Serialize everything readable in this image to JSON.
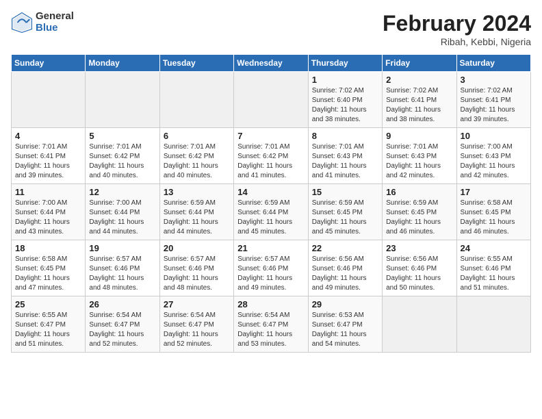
{
  "logo": {
    "general": "General",
    "blue": "Blue"
  },
  "title": "February 2024",
  "location": "Ribah, Kebbi, Nigeria",
  "days_of_week": [
    "Sunday",
    "Monday",
    "Tuesday",
    "Wednesday",
    "Thursday",
    "Friday",
    "Saturday"
  ],
  "weeks": [
    [
      {
        "day": "",
        "info": ""
      },
      {
        "day": "",
        "info": ""
      },
      {
        "day": "",
        "info": ""
      },
      {
        "day": "",
        "info": ""
      },
      {
        "day": "1",
        "info": "Sunrise: 7:02 AM\nSunset: 6:40 PM\nDaylight: 11 hours and 38 minutes."
      },
      {
        "day": "2",
        "info": "Sunrise: 7:02 AM\nSunset: 6:41 PM\nDaylight: 11 hours and 38 minutes."
      },
      {
        "day": "3",
        "info": "Sunrise: 7:02 AM\nSunset: 6:41 PM\nDaylight: 11 hours and 39 minutes."
      }
    ],
    [
      {
        "day": "4",
        "info": "Sunrise: 7:01 AM\nSunset: 6:41 PM\nDaylight: 11 hours and 39 minutes."
      },
      {
        "day": "5",
        "info": "Sunrise: 7:01 AM\nSunset: 6:42 PM\nDaylight: 11 hours and 40 minutes."
      },
      {
        "day": "6",
        "info": "Sunrise: 7:01 AM\nSunset: 6:42 PM\nDaylight: 11 hours and 40 minutes."
      },
      {
        "day": "7",
        "info": "Sunrise: 7:01 AM\nSunset: 6:42 PM\nDaylight: 11 hours and 41 minutes."
      },
      {
        "day": "8",
        "info": "Sunrise: 7:01 AM\nSunset: 6:43 PM\nDaylight: 11 hours and 41 minutes."
      },
      {
        "day": "9",
        "info": "Sunrise: 7:01 AM\nSunset: 6:43 PM\nDaylight: 11 hours and 42 minutes."
      },
      {
        "day": "10",
        "info": "Sunrise: 7:00 AM\nSunset: 6:43 PM\nDaylight: 11 hours and 42 minutes."
      }
    ],
    [
      {
        "day": "11",
        "info": "Sunrise: 7:00 AM\nSunset: 6:44 PM\nDaylight: 11 hours and 43 minutes."
      },
      {
        "day": "12",
        "info": "Sunrise: 7:00 AM\nSunset: 6:44 PM\nDaylight: 11 hours and 44 minutes."
      },
      {
        "day": "13",
        "info": "Sunrise: 6:59 AM\nSunset: 6:44 PM\nDaylight: 11 hours and 44 minutes."
      },
      {
        "day": "14",
        "info": "Sunrise: 6:59 AM\nSunset: 6:44 PM\nDaylight: 11 hours and 45 minutes."
      },
      {
        "day": "15",
        "info": "Sunrise: 6:59 AM\nSunset: 6:45 PM\nDaylight: 11 hours and 45 minutes."
      },
      {
        "day": "16",
        "info": "Sunrise: 6:59 AM\nSunset: 6:45 PM\nDaylight: 11 hours and 46 minutes."
      },
      {
        "day": "17",
        "info": "Sunrise: 6:58 AM\nSunset: 6:45 PM\nDaylight: 11 hours and 46 minutes."
      }
    ],
    [
      {
        "day": "18",
        "info": "Sunrise: 6:58 AM\nSunset: 6:45 PM\nDaylight: 11 hours and 47 minutes."
      },
      {
        "day": "19",
        "info": "Sunrise: 6:57 AM\nSunset: 6:46 PM\nDaylight: 11 hours and 48 minutes."
      },
      {
        "day": "20",
        "info": "Sunrise: 6:57 AM\nSunset: 6:46 PM\nDaylight: 11 hours and 48 minutes."
      },
      {
        "day": "21",
        "info": "Sunrise: 6:57 AM\nSunset: 6:46 PM\nDaylight: 11 hours and 49 minutes."
      },
      {
        "day": "22",
        "info": "Sunrise: 6:56 AM\nSunset: 6:46 PM\nDaylight: 11 hours and 49 minutes."
      },
      {
        "day": "23",
        "info": "Sunrise: 6:56 AM\nSunset: 6:46 PM\nDaylight: 11 hours and 50 minutes."
      },
      {
        "day": "24",
        "info": "Sunrise: 6:55 AM\nSunset: 6:46 PM\nDaylight: 11 hours and 51 minutes."
      }
    ],
    [
      {
        "day": "25",
        "info": "Sunrise: 6:55 AM\nSunset: 6:47 PM\nDaylight: 11 hours and 51 minutes."
      },
      {
        "day": "26",
        "info": "Sunrise: 6:54 AM\nSunset: 6:47 PM\nDaylight: 11 hours and 52 minutes."
      },
      {
        "day": "27",
        "info": "Sunrise: 6:54 AM\nSunset: 6:47 PM\nDaylight: 11 hours and 52 minutes."
      },
      {
        "day": "28",
        "info": "Sunrise: 6:54 AM\nSunset: 6:47 PM\nDaylight: 11 hours and 53 minutes."
      },
      {
        "day": "29",
        "info": "Sunrise: 6:53 AM\nSunset: 6:47 PM\nDaylight: 11 hours and 54 minutes."
      },
      {
        "day": "",
        "info": ""
      },
      {
        "day": "",
        "info": ""
      }
    ]
  ]
}
